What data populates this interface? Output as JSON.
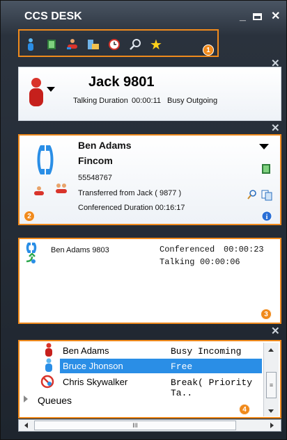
{
  "window": {
    "title": "CCS DESK",
    "minimize": "_",
    "maximize": "▭",
    "close": "✕"
  },
  "toolbar": {
    "icons": [
      "agent-icon",
      "directory-icon",
      "transfer-icon",
      "queue-icon",
      "clock-icon",
      "search-icon",
      "favorites-icon"
    ],
    "badge": "1"
  },
  "agent": {
    "name": "Jack 9801",
    "duration_label": "Talking Duration",
    "duration": "00:00:11",
    "status": "Busy Outgoing"
  },
  "call": {
    "name": "Ben Adams",
    "company": "Fincom",
    "number": "55548767",
    "transfer_text": "Transferred from Jack ( 9877 )",
    "conference_text": "Conferenced Duration 00:16:17",
    "badge": "2"
  },
  "calls_list": {
    "badge": "3",
    "entry": {
      "name": "Ben Adams 9803",
      "status1": "Conferenced",
      "time1": "00:00:23",
      "status2": "Talking",
      "time2": "00:00:06"
    }
  },
  "contacts": {
    "badge": "4",
    "rows": [
      {
        "name": "Ben Adams",
        "status": "Busy Incoming"
      },
      {
        "name": "Bruce Jhonson",
        "status": "Free"
      },
      {
        "name": "Chris Skywalker",
        "status": "Break( Priority Ta.."
      }
    ],
    "group_label": "Queues"
  },
  "scroll": {
    "h_thumb": "III"
  },
  "colors": {
    "accent": "#f08a1c",
    "selected_row": "#2a8ee6",
    "bg_dark": "#1e252e"
  }
}
